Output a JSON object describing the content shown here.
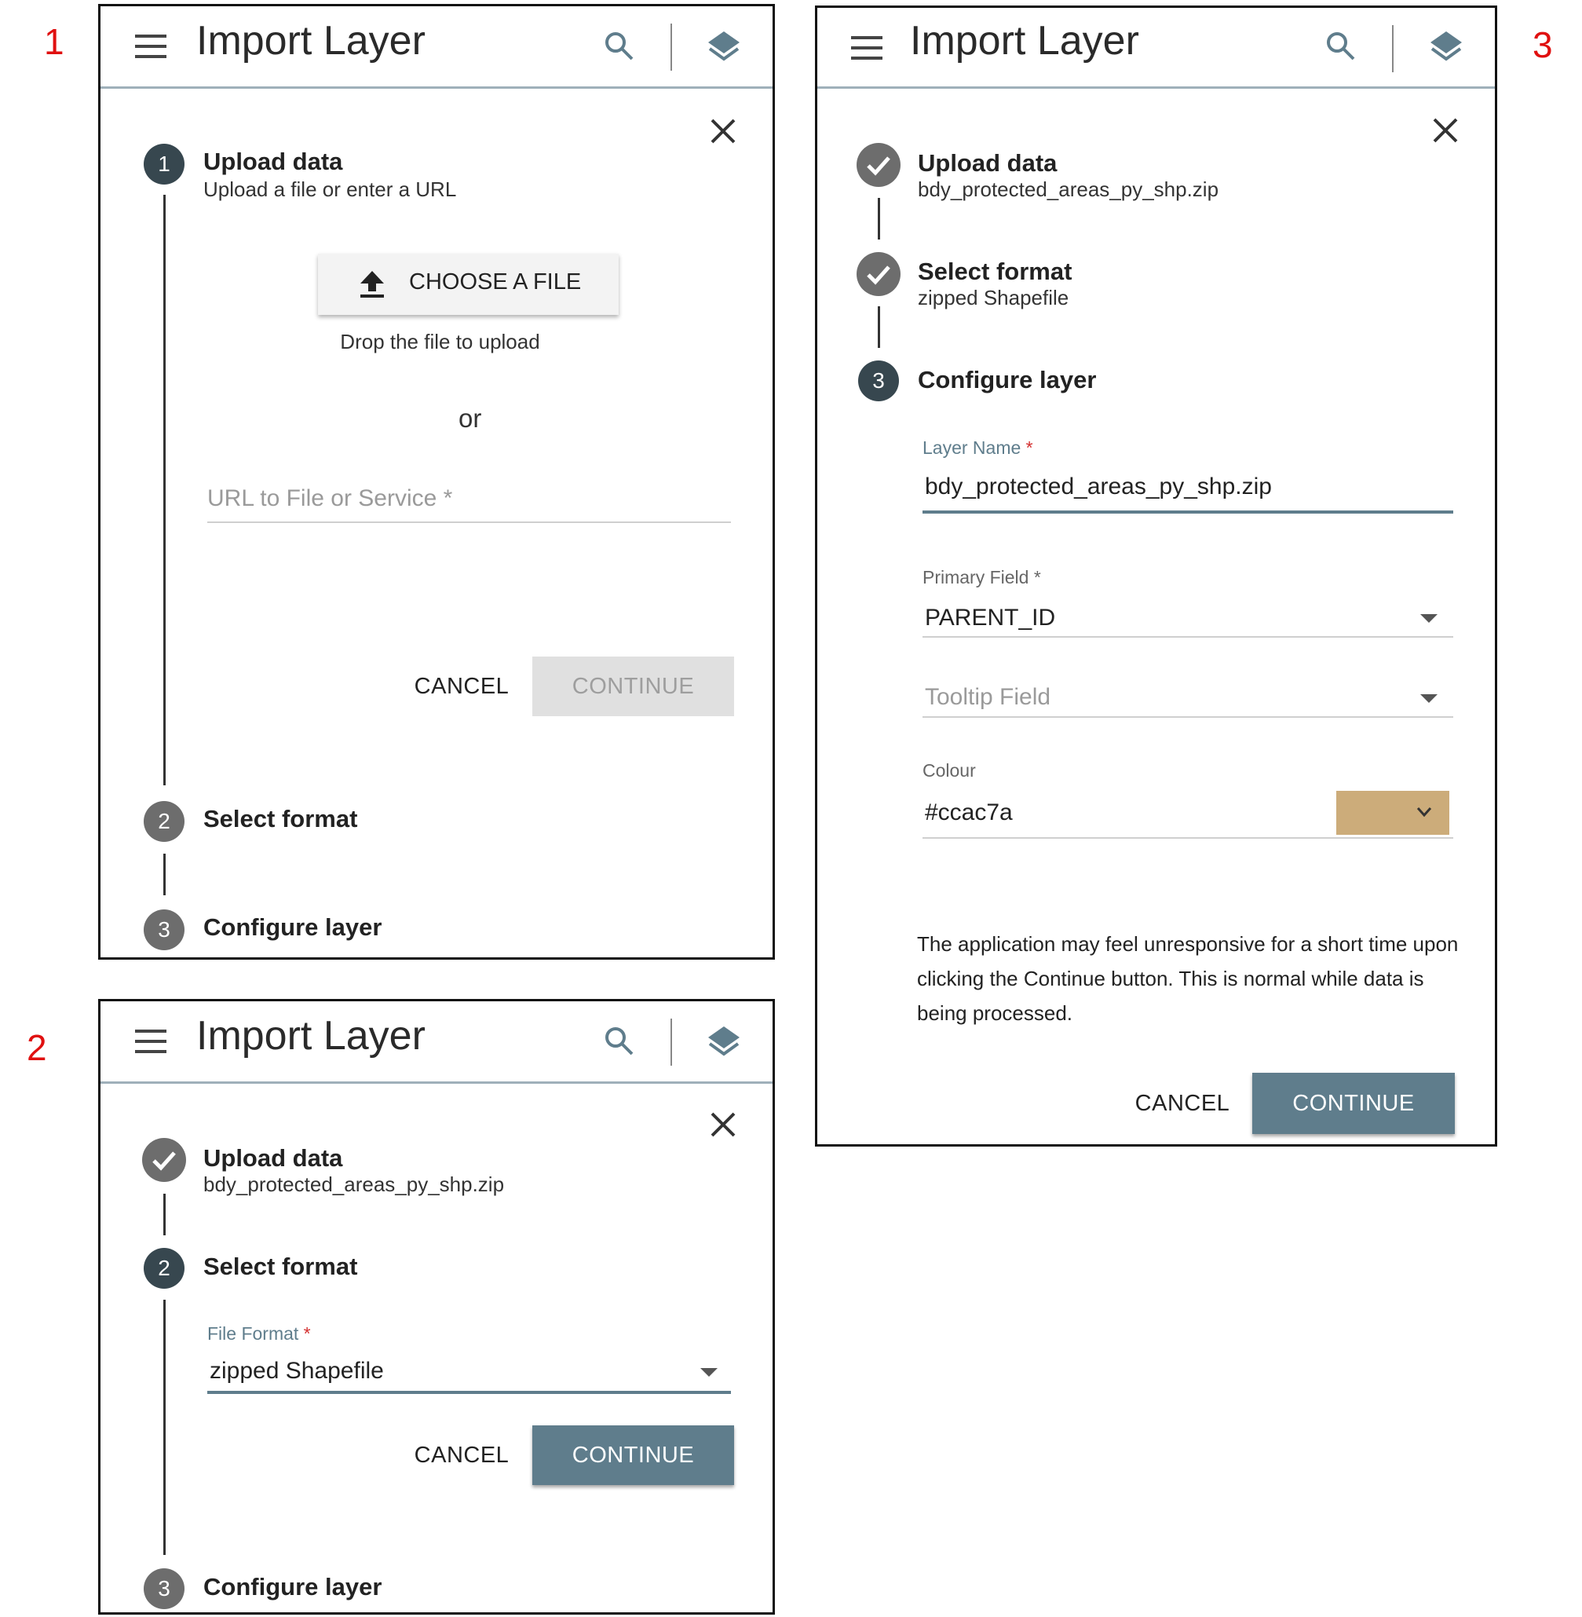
{
  "labels": {
    "p1": "1",
    "p2": "2",
    "p3": "3"
  },
  "header": {
    "title": "Import Layer"
  },
  "steps": {
    "upload": "Upload data",
    "format": "Select format",
    "configure": "Configure layer",
    "n1": "1",
    "n2": "2",
    "n3": "3"
  },
  "panel1": {
    "upload_sub": "Upload a file or enter a URL",
    "choose_label": "CHOOSE A FILE",
    "drop_hint": "Drop the file to upload",
    "or": "or",
    "url_placeholder": "URL to File or Service *",
    "cancel": "CANCEL",
    "continue": "CONTINUE"
  },
  "panel2": {
    "upload_sub": "bdy_protected_areas_py_shp.zip",
    "file_format_label": "File Format",
    "file_format_value": "zipped Shapefile",
    "cancel": "CANCEL",
    "continue": "CONTINUE"
  },
  "panel3": {
    "upload_sub": "bdy_protected_areas_py_shp.zip",
    "format_sub": "zipped Shapefile",
    "layer_name_label": "Layer Name",
    "layer_name_value": "bdy_protected_areas_py_shp.zip",
    "primary_field_label": "Primary Field",
    "primary_field_value": "PARENT_ID",
    "tooltip_placeholder": "Tooltip Field",
    "colour_label": "Colour",
    "colour_value": "#ccac7a",
    "note": "The application may feel unresponsive for a short time upon clicking the Continue button. This is normal while data is being processed.",
    "cancel": "CANCEL",
    "continue": "CONTINUE"
  },
  "colors": {
    "accent": "#5f7d8c",
    "swatch": "#ccac7a",
    "required": "#d32f2f",
    "marker": "#e01010"
  },
  "icons": [
    "menu-icon",
    "search-icon",
    "layers-icon",
    "close-icon",
    "upload-icon",
    "check-icon",
    "dropdown-caret-icon",
    "chevron-down-icon"
  ]
}
